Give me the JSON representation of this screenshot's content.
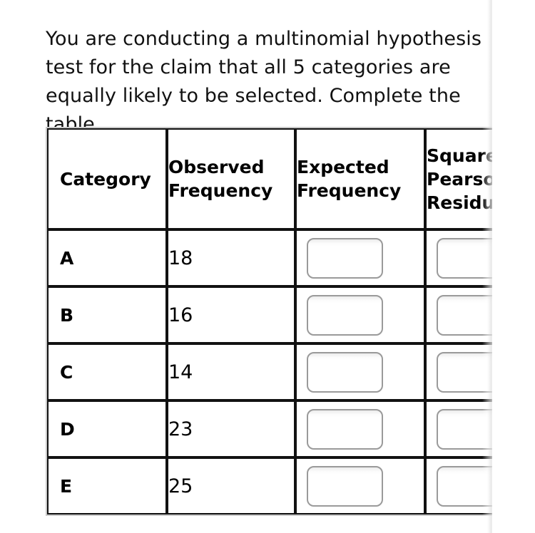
{
  "prompt": {
    "text": "You are conducting a multinomial hypothesis test for the claim that all 5 categories are equally likely to be selected. Complete the table."
  },
  "table": {
    "headers": {
      "category": "Category",
      "observed_frequency": "Observed\nFrequency",
      "expected_frequency": "Expected\nFrequency",
      "squared_pearson_residual": "Squared\nPearson\nResidual"
    },
    "rows": [
      {
        "category": "A",
        "observed_frequency": "18",
        "expected_frequency": "",
        "expected_frequency_placeholder": "",
        "squared_pearson_residual": "",
        "squared_pearson_residual_placeholder": ""
      },
      {
        "category": "B",
        "observed_frequency": "16",
        "expected_frequency": "",
        "expected_frequency_placeholder": "",
        "squared_pearson_residual": "",
        "squared_pearson_residual_placeholder": ""
      },
      {
        "category": "C",
        "observed_frequency": "14",
        "expected_frequency": "",
        "expected_frequency_placeholder": "",
        "squared_pearson_residual": "",
        "squared_pearson_residual_placeholder": ""
      },
      {
        "category": "D",
        "observed_frequency": "23",
        "expected_frequency": "",
        "expected_frequency_placeholder": "",
        "squared_pearson_residual": "",
        "squared_pearson_residual_placeholder": ""
      },
      {
        "category": "E",
        "observed_frequency": "25",
        "expected_frequency": "",
        "expected_frequency_placeholder": "",
        "squared_pearson_residual": "",
        "squared_pearson_residual_placeholder": ""
      }
    ]
  },
  "colors": {
    "page_background": "#ffffff",
    "text": "#111111",
    "cell_border": "#111111",
    "table_outer_border": "#c9c9c9",
    "input_border": "#9a9a9a",
    "input_background": "#ffffff"
  }
}
